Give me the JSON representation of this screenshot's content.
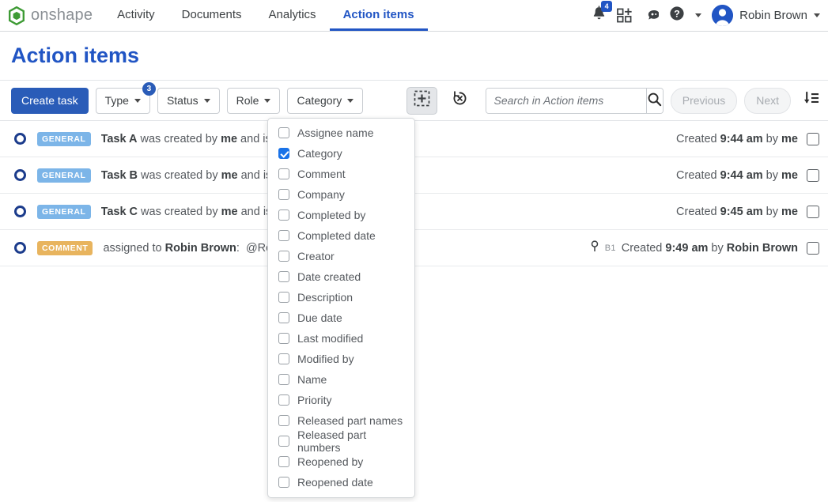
{
  "topnav": {
    "brand": "onshape",
    "brand_logo_icon": "onshape-logo-icon",
    "brand_color": "#3e9b35",
    "tabs": [
      {
        "label": "Activity",
        "active": false
      },
      {
        "label": "Documents",
        "active": false
      },
      {
        "label": "Analytics",
        "active": false
      },
      {
        "label": "Action items",
        "active": true
      }
    ],
    "active_tab_color": "#2155c4",
    "notifications": {
      "icon": "bell-icon",
      "count": "4",
      "badge_color": "#2155c4"
    },
    "apps_icon": "apps-grid-plus-icon",
    "learning_icon": "learning-brain-icon",
    "help_icon": "help-question-icon",
    "help_caret_icon": "chevron-down-icon",
    "user": {
      "name": "Robin Brown",
      "avatar_icon": "user-avatar",
      "caret_icon": "chevron-down-icon"
    }
  },
  "page": {
    "title": "Action items"
  },
  "toolbar": {
    "create_label": "Create task",
    "filters": [
      {
        "label": "Type",
        "badge": "3"
      },
      {
        "label": "Status",
        "badge": ""
      },
      {
        "label": "Role",
        "badge": ""
      },
      {
        "label": "Category",
        "badge": ""
      }
    ],
    "add_column_icon": "add-column-icon",
    "reset_icon": "reset-filters-icon",
    "search": {
      "placeholder": "Search in Action items",
      "value": ""
    },
    "search_icon": "search-icon",
    "previous_label": "Previous",
    "next_label": "Next",
    "sort_icon": "sort-descending-icon"
  },
  "rows": [
    {
      "status_icon": "status-open-circle-icon",
      "tag": "GENERAL",
      "tag_type": "general",
      "text_html": "<b>Task A</b> was created by <b>me</b> and is as",
      "ref": "",
      "pin": false,
      "meta_html": "Created <b>9:44 am</b> by <b>me</b>"
    },
    {
      "status_icon": "status-open-circle-icon",
      "tag": "GENERAL",
      "tag_type": "general",
      "text_html": "<b>Task B</b> was created by <b>me</b> and is as",
      "ref": "",
      "pin": false,
      "meta_html": "Created <b>9:44 am</b> by <b>me</b>"
    },
    {
      "status_icon": "status-open-circle-icon",
      "tag": "GENERAL",
      "tag_type": "general",
      "text_html": "<b>Task C</b> was created by <b>me</b> and is as",
      "ref": "",
      "pin": false,
      "meta_html": "Created <b>9:45 am</b> by <b>me</b>"
    },
    {
      "status_icon": "status-open-circle-icon",
      "tag": "COMMENT",
      "tag_type": "comment",
      "text_html": "assigned to <b>Robin Brown</b>: &nbsp;@Robin",
      "ref": "B1",
      "pin": true,
      "meta_html": "Created <b>9:49 am</b> by <b>Robin Brown</b>"
    }
  ],
  "column_dropdown": {
    "items": [
      {
        "label": "Assignee name",
        "checked": false
      },
      {
        "label": "Category",
        "checked": true
      },
      {
        "label": "Comment",
        "checked": false
      },
      {
        "label": "Company",
        "checked": false
      },
      {
        "label": "Completed by",
        "checked": false
      },
      {
        "label": "Completed date",
        "checked": false
      },
      {
        "label": "Creator",
        "checked": false
      },
      {
        "label": "Date created",
        "checked": false
      },
      {
        "label": "Description",
        "checked": false
      },
      {
        "label": "Due date",
        "checked": false
      },
      {
        "label": "Last modified",
        "checked": false
      },
      {
        "label": "Modified by",
        "checked": false
      },
      {
        "label": "Name",
        "checked": false
      },
      {
        "label": "Priority",
        "checked": false
      },
      {
        "label": "Released part names",
        "checked": false
      },
      {
        "label": "Released part numbers",
        "checked": false
      },
      {
        "label": "Reopened by",
        "checked": false
      },
      {
        "label": "Reopened date",
        "checked": false
      }
    ],
    "checked_color": "#1a73e8"
  }
}
